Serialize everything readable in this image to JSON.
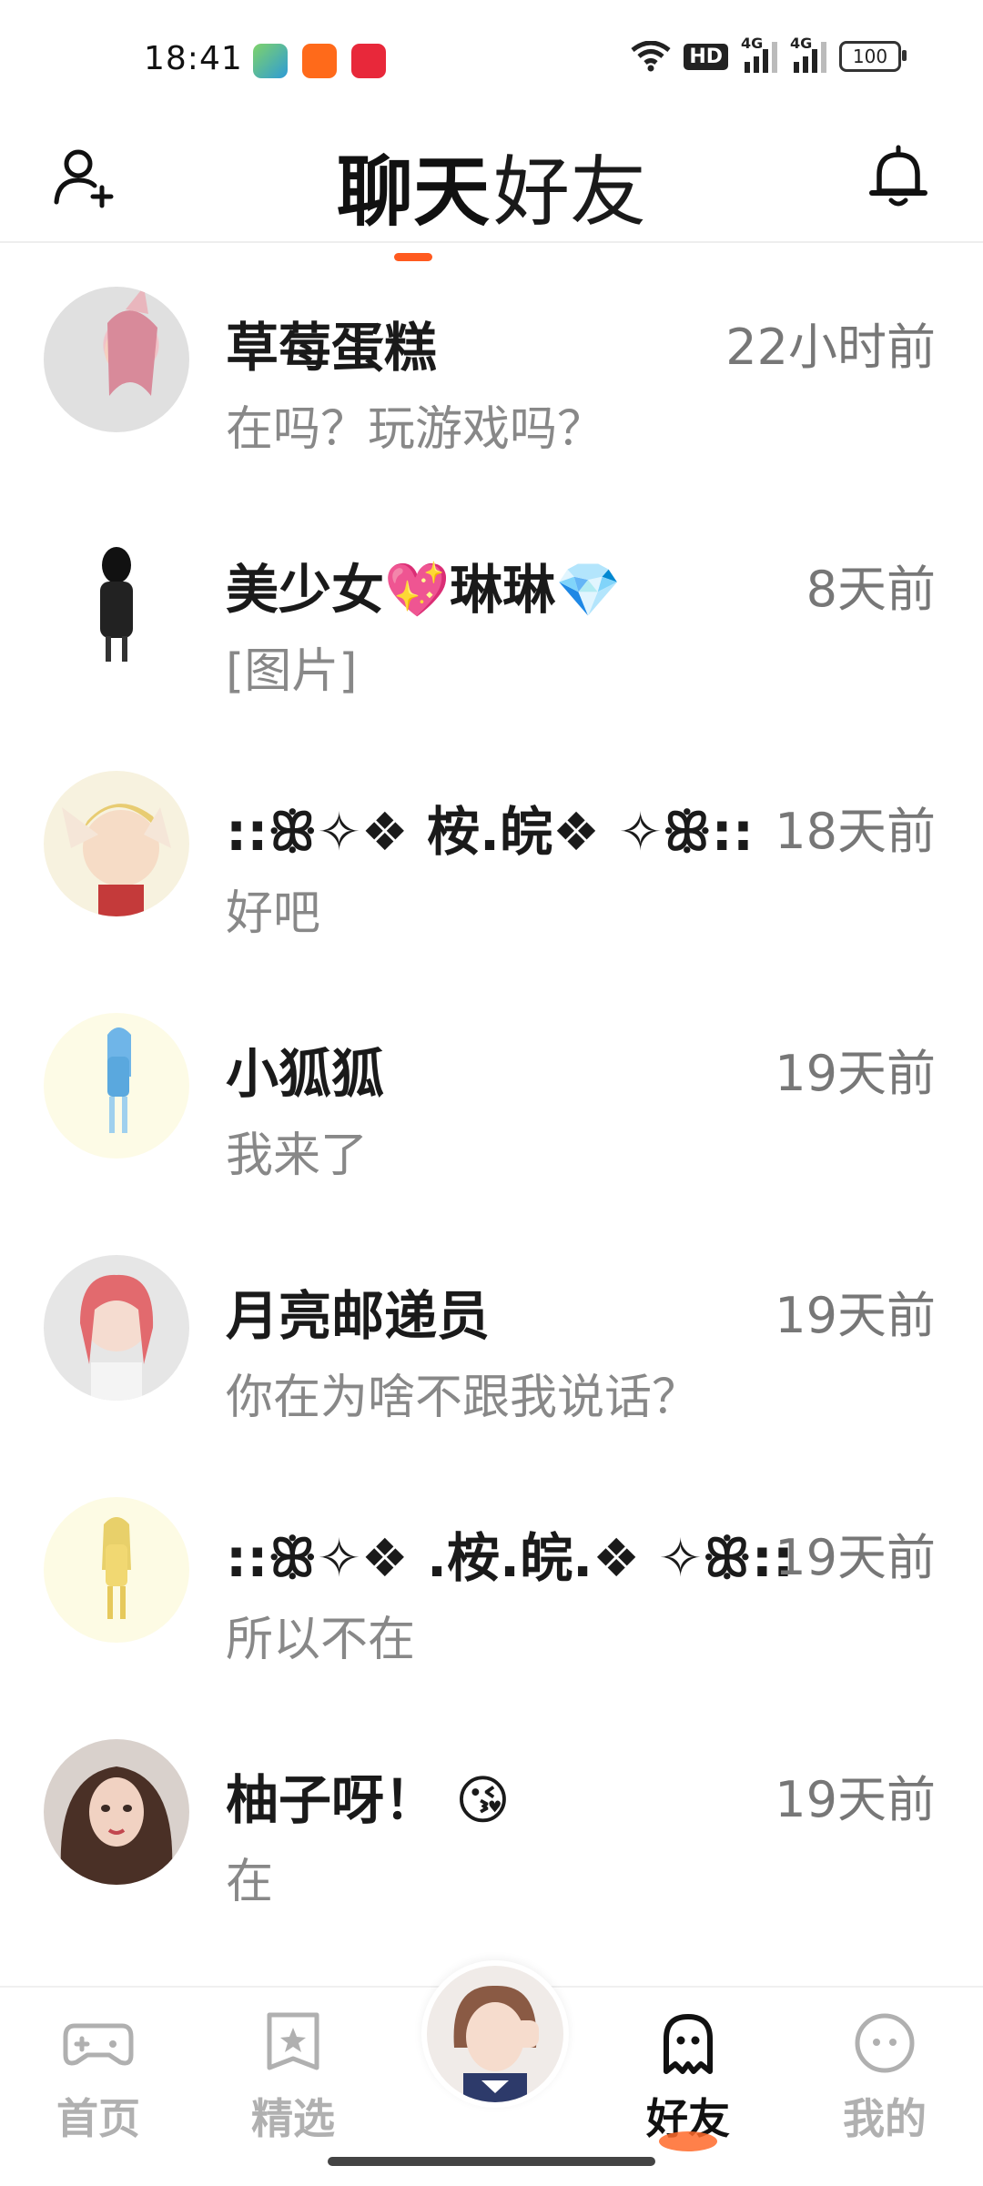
{
  "status_bar": {
    "time": "18:41",
    "hd_label": "HD",
    "network_1": "4G",
    "network_2": "4G",
    "battery": "100"
  },
  "header": {
    "tabs": [
      {
        "label": "聊天",
        "active": true
      },
      {
        "label": "好友",
        "active": false
      }
    ],
    "left_icon": "add-friend-icon",
    "right_icon": "bell-icon"
  },
  "chats": [
    {
      "name": "草莓蛋糕",
      "time": "22小时前",
      "message": "在吗？玩游戏吗？"
    },
    {
      "name": "美少女💖琳琳💎",
      "time": "8天前",
      "message": "[图片]"
    },
    {
      "name": "::ꕥ✧❖ 桉.皖❖ ✧ꕥ::",
      "time": "18天前",
      "message": "好吧"
    },
    {
      "name": "小狐狐",
      "time": "19天前",
      "message": "我来了"
    },
    {
      "name": "月亮邮递员",
      "time": "19天前",
      "message": "你在为啥不跟我说话？"
    },
    {
      "name": "::ꕥ✧❖ .桉.皖.❖ ✧ꕥ::",
      "time": "19天前",
      "message": "所以不在"
    },
    {
      "name": "柚子呀！ 😘",
      "time": "19天前",
      "message": "在"
    }
  ],
  "bottom_nav": {
    "items": [
      {
        "label": "首页",
        "icon": "gamepad-icon",
        "active": false
      },
      {
        "label": "精选",
        "icon": "star-bookmark-icon",
        "active": false
      },
      {
        "label": "好友",
        "icon": "ghost-icon",
        "active": true
      },
      {
        "label": "我的",
        "icon": "smile-face-icon",
        "active": false
      }
    ]
  },
  "colors": {
    "accent": "#ff5a1f",
    "text_primary": "#1a1a1a",
    "text_secondary": "#888888",
    "nav_inactive": "#b0b0b0"
  }
}
